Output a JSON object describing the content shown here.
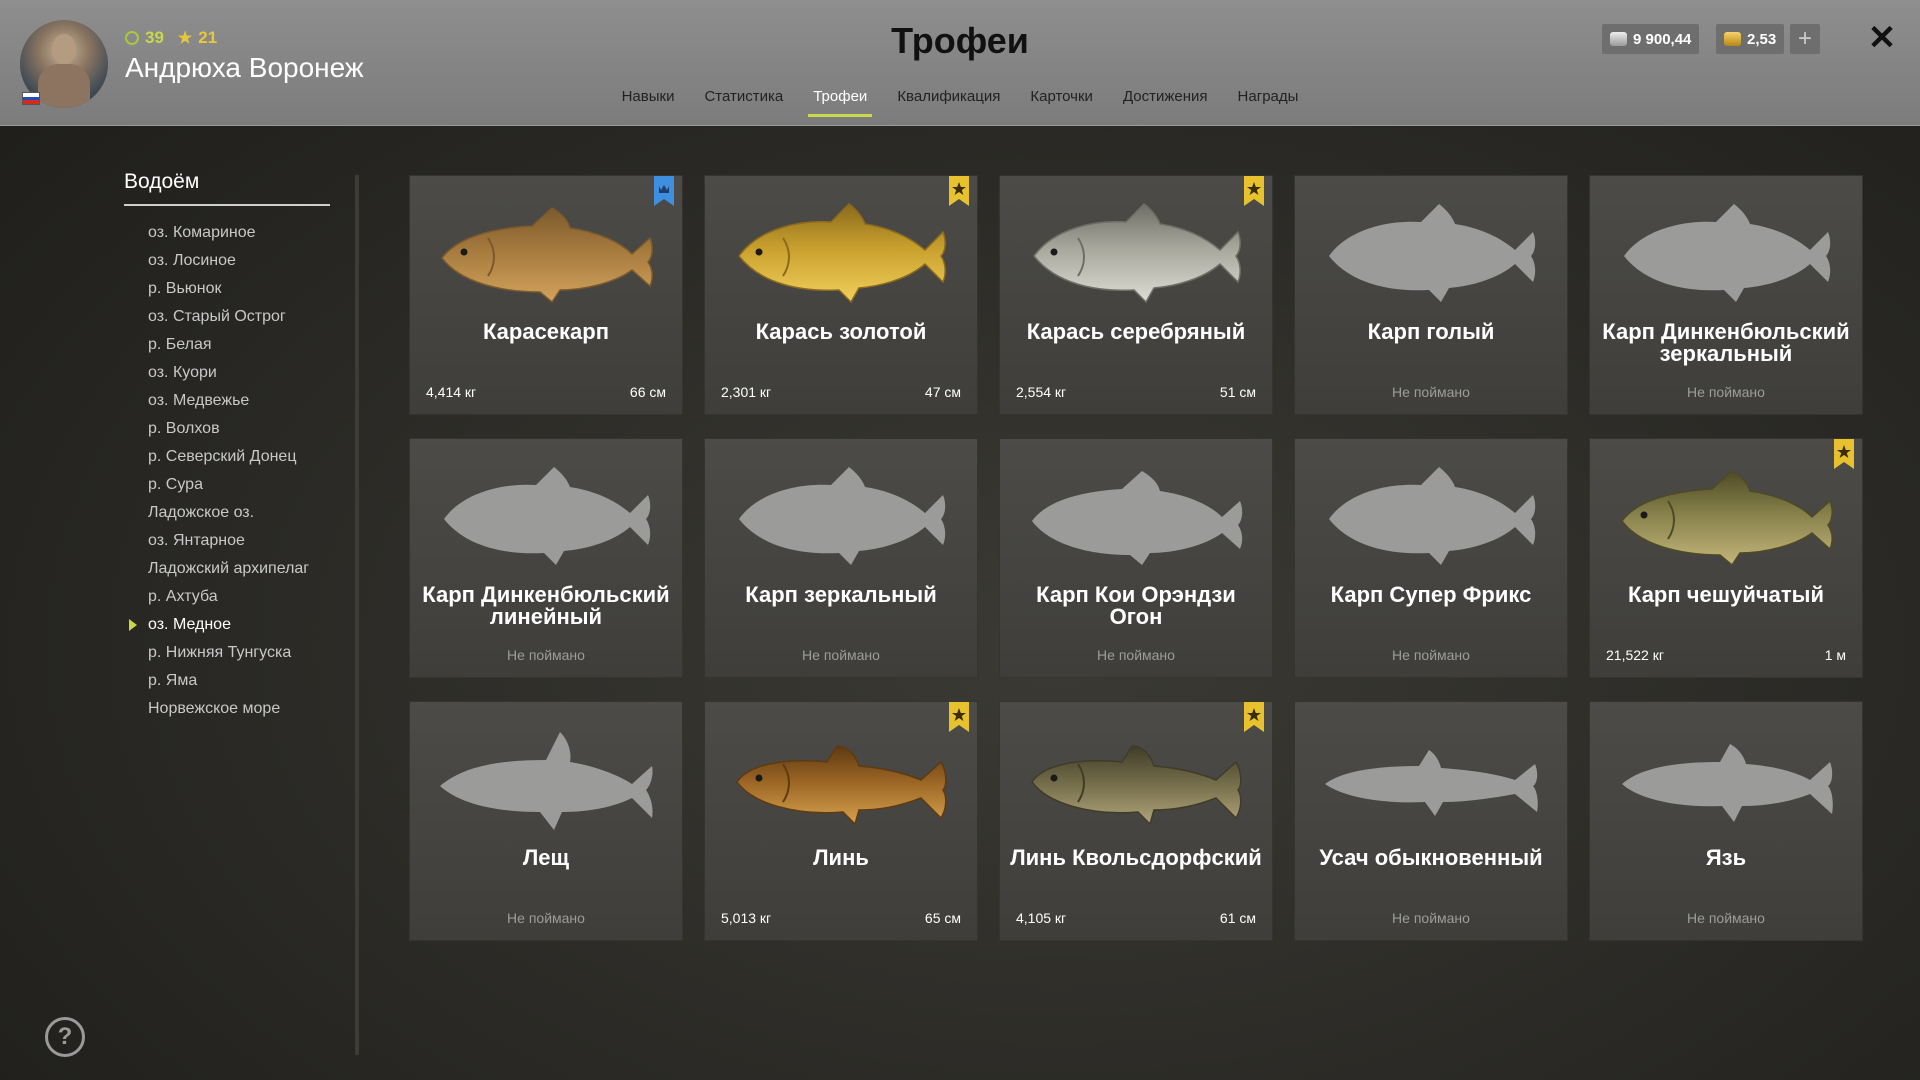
{
  "player": {
    "level": "39",
    "rank": "21",
    "name": "Андрюха Воронеж",
    "flag_colors": [
      "#ffffff",
      "#1e4fb5",
      "#d52b1e"
    ]
  },
  "page_title": "Трофеи",
  "tabs": [
    {
      "label": "Навыки"
    },
    {
      "label": "Статистика"
    },
    {
      "label": "Трофеи",
      "active": true
    },
    {
      "label": "Квалификация"
    },
    {
      "label": "Карточки"
    },
    {
      "label": "Достижения"
    },
    {
      "label": "Награды"
    }
  ],
  "currency": {
    "silver": "9 900,44",
    "gold": "2,53",
    "add_icon": "plus-icon"
  },
  "close_icon": "close-icon",
  "sidebar": {
    "title": "Водоём",
    "items": [
      {
        "label": "оз. Комариное"
      },
      {
        "label": "оз. Лосиное"
      },
      {
        "label": "р. Вьюнок"
      },
      {
        "label": "оз. Старый Острог"
      },
      {
        "label": "р. Белая"
      },
      {
        "label": "оз. Куори"
      },
      {
        "label": "оз. Медвежье"
      },
      {
        "label": "р. Волхов"
      },
      {
        "label": "р. Северский Донец"
      },
      {
        "label": "р. Сура"
      },
      {
        "label": "Ладожское оз."
      },
      {
        "label": "оз. Янтарное"
      },
      {
        "label": "Ладожский архипелаг"
      },
      {
        "label": "р. Ахтуба"
      },
      {
        "label": "оз. Медное",
        "active": true
      },
      {
        "label": "р. Нижняя Тунгуска"
      },
      {
        "label": "р. Яма"
      },
      {
        "label": "Норвежское море"
      }
    ]
  },
  "trophies": [
    {
      "name": "Карасекарп",
      "caught": true,
      "weight": "4,414 кг",
      "length": "66 см",
      "badge": "blue",
      "shape": "carp",
      "colors": [
        "#7a5a2c",
        "#a67a3e",
        "#d3a35c"
      ]
    },
    {
      "name": "Карась золотой",
      "caught": true,
      "weight": "2,301 кг",
      "length": "47 см",
      "badge": "yellow",
      "shape": "crucian",
      "colors": [
        "#8a6a1c",
        "#c9a02e",
        "#f1cf5c"
      ]
    },
    {
      "name": "Карась серебряный",
      "caught": true,
      "weight": "2,554 кг",
      "length": "51 см",
      "badge": "yellow",
      "shape": "crucian",
      "colors": [
        "#6e6e66",
        "#a8a79c",
        "#dcdcd2"
      ]
    },
    {
      "name": "Карп голый",
      "caught": false,
      "status": "Не поймано",
      "shape": "crucian"
    },
    {
      "name": "Карп Динкенбюльский зеркальный",
      "caught": false,
      "status": "Не поймано",
      "shape": "crucian"
    },
    {
      "name": "Карп Динкенбюльский линейный",
      "caught": false,
      "status": "Не поймано",
      "shape": "crucian"
    },
    {
      "name": "Карп зеркальный",
      "caught": false,
      "status": "Не поймано",
      "shape": "crucian"
    },
    {
      "name": "Карп Кои Орэндзи Огон",
      "caught": false,
      "status": "Не поймано",
      "shape": "carp"
    },
    {
      "name": "Карп Супер Фрикс",
      "caught": false,
      "status": "Не поймано",
      "shape": "crucian"
    },
    {
      "name": "Карп чешуйчатый",
      "caught": true,
      "weight": "21,522 кг",
      "length": "1 м",
      "badge": "yellow",
      "shape": "carp",
      "colors": [
        "#4e4a26",
        "#86804a",
        "#c4b67c"
      ]
    },
    {
      "name": "Лещ",
      "caught": false,
      "status": "Не поймано",
      "shape": "bream"
    },
    {
      "name": "Линь",
      "caught": true,
      "weight": "5,013 кг",
      "length": "65 см",
      "badge": "yellow",
      "shape": "tench",
      "colors": [
        "#5e3a12",
        "#9a6424",
        "#d6a24c"
      ]
    },
    {
      "name": "Линь Квольсдорфский",
      "caught": true,
      "weight": "4,105 кг",
      "length": "61 см",
      "badge": "yellow",
      "shape": "tench",
      "colors": [
        "#3f3c28",
        "#716a48",
        "#b0a47a"
      ]
    },
    {
      "name": "Усач обыкновенный",
      "caught": false,
      "status": "Не поймано",
      "shape": "barbel"
    },
    {
      "name": "Язь",
      "caught": false,
      "status": "Не поймано",
      "shape": "ide"
    }
  ],
  "help_icon": "help-icon"
}
